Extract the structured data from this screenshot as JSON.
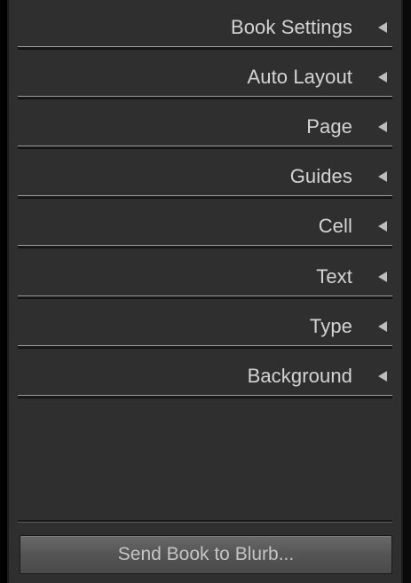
{
  "panel": {
    "sections": [
      {
        "label": "Book Settings",
        "icon": "collapse-arrow-icon"
      },
      {
        "label": "Auto Layout",
        "icon": "collapse-arrow-icon"
      },
      {
        "label": "Page",
        "icon": "collapse-arrow-icon"
      },
      {
        "label": "Guides",
        "icon": "collapse-arrow-icon"
      },
      {
        "label": "Cell",
        "icon": "collapse-arrow-icon"
      },
      {
        "label": "Text",
        "icon": "collapse-arrow-icon"
      },
      {
        "label": "Type",
        "icon": "collapse-arrow-icon"
      },
      {
        "label": "Background",
        "icon": "collapse-arrow-icon"
      }
    ],
    "send_button_label": "Send Book to Blurb...",
    "colors": {
      "panel_background": "#2f2f2f",
      "label_text": "#d4d4d4",
      "button_background": "#5a5a5a"
    }
  }
}
